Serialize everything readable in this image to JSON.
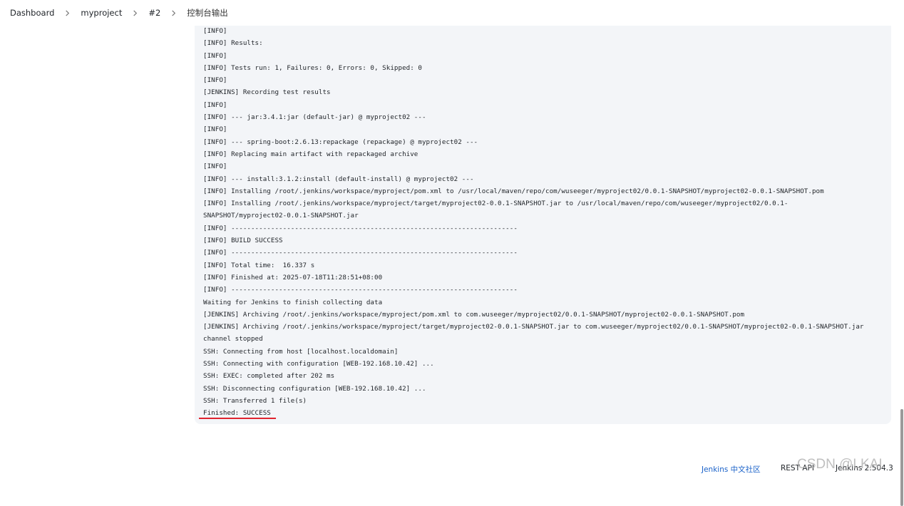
{
  "breadcrumb": {
    "items": [
      "Dashboard",
      "myproject",
      "#2",
      "控制台输出"
    ]
  },
  "console": {
    "lines": [
      "[INFO]",
      "[INFO] Results:",
      "[INFO]",
      "[INFO] Tests run: 1, Failures: 0, Errors: 0, Skipped: 0",
      "[INFO]",
      "[JENKINS] Recording test results",
      "[INFO]",
      "[INFO] --- jar:3.4.1:jar (default-jar) @ myproject02 ---",
      "[INFO]",
      "[INFO] --- spring-boot:2.6.13:repackage (repackage) @ myproject02 ---",
      "[INFO] Replacing main artifact with repackaged archive",
      "[INFO]",
      "[INFO] --- install:3.1.2:install (default-install) @ myproject02 ---",
      "[INFO] Installing /root/.jenkins/workspace/myproject/pom.xml to /usr/local/maven/repo/com/wuseeger/myproject02/0.0.1-SNAPSHOT/myproject02-0.0.1-SNAPSHOT.pom",
      "[INFO] Installing /root/.jenkins/workspace/myproject/target/myproject02-0.0.1-SNAPSHOT.jar to /usr/local/maven/repo/com/wuseeger/myproject02/0.0.1-",
      "SNAPSHOT/myproject02-0.0.1-SNAPSHOT.jar",
      "[INFO] ------------------------------------------------------------------------",
      "[INFO] BUILD SUCCESS",
      "[INFO] ------------------------------------------------------------------------",
      "[INFO] Total time:  16.337 s",
      "[INFO] Finished at: 2025-07-18T11:28:51+08:00",
      "[INFO] ------------------------------------------------------------------------",
      "Waiting for Jenkins to finish collecting data",
      "[JENKINS] Archiving /root/.jenkins/workspace/myproject/pom.xml to com.wuseeger/myproject02/0.0.1-SNAPSHOT/myproject02-0.0.1-SNAPSHOT.pom",
      "[JENKINS] Archiving /root/.jenkins/workspace/myproject/target/myproject02-0.0.1-SNAPSHOT.jar to com.wuseeger/myproject02/0.0.1-SNAPSHOT/myproject02-0.0.1-SNAPSHOT.jar",
      "channel stopped",
      "SSH: Connecting from host [localhost.localdomain]",
      "SSH: Connecting with configuration [WEB-192.168.10.42] ...",
      "SSH: EXEC: completed after 202 ms",
      "SSH: Disconnecting configuration [WEB-192.168.10.42] ...",
      "SSH: Transferred 1 file(s)",
      "Finished: SUCCESS"
    ]
  },
  "footer": {
    "community_link": "Jenkins 中文社区",
    "rest_api": "REST API",
    "version": "Jenkins 2.504.3"
  },
  "watermark": "CSDN @LKAI.",
  "colors": {
    "console_bg": "#f3f5f8",
    "link": "#1a62c9",
    "highlight_underline": "#e0242f"
  }
}
